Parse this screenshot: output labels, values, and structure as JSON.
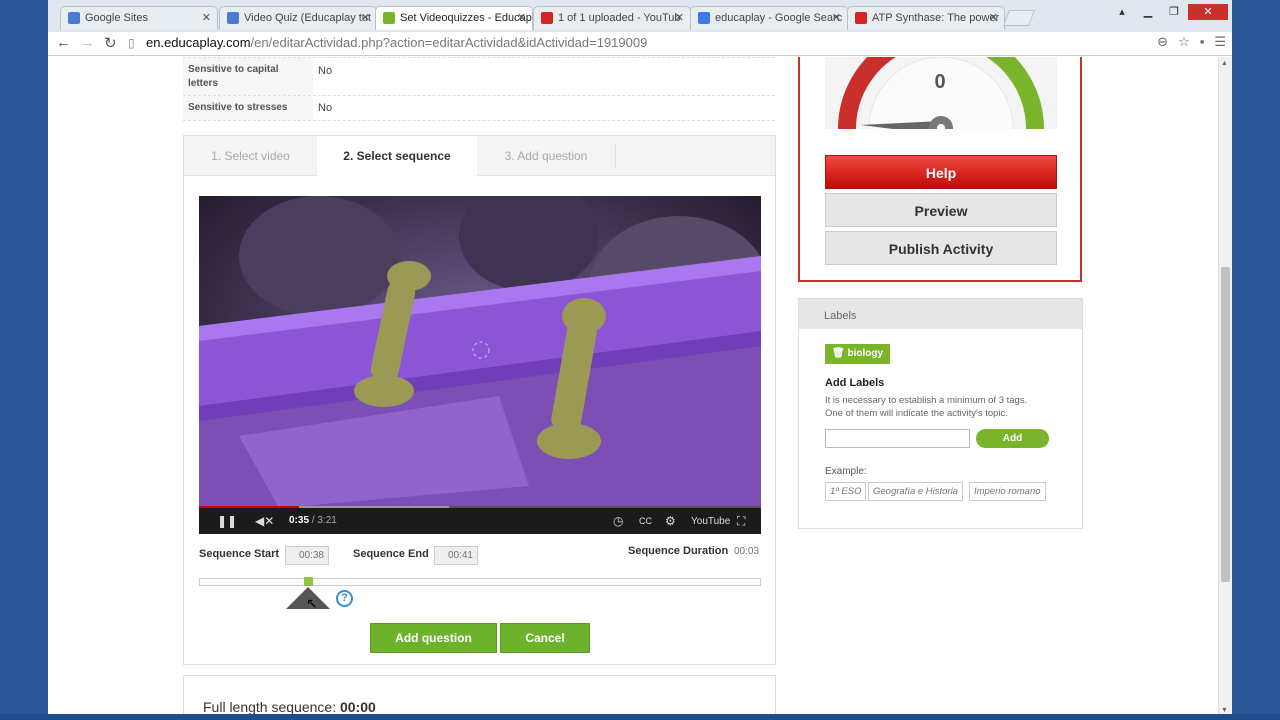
{
  "browser": {
    "tabs": [
      {
        "title": "Google Sites",
        "favicon_color": "#4a7bd0"
      },
      {
        "title": "Video Quiz (Educaplay tut",
        "favicon_color": "#4a7bd0"
      },
      {
        "title": "Set Videoquizzes - Educap",
        "favicon_color": "#7ab42a"
      },
      {
        "title": "1 of 1 uploaded - YouTub",
        "favicon_color": "#d32323"
      },
      {
        "title": "educaplay - Google Searc",
        "favicon_color": "#3b78e7"
      },
      {
        "title": "ATP Synthase: The power",
        "favicon_color": "#d32323"
      }
    ],
    "active_tab_index": 2,
    "url_host": "en.educaplay.com",
    "url_path": "/en/editarActividad.php?action=editarActividad&idActividad=1919009"
  },
  "settings": [
    {
      "key": "Sensitive to capital letters",
      "value": "No"
    },
    {
      "key": "Sensitive to stresses",
      "value": "No"
    }
  ],
  "steps": [
    {
      "label": "1. Select video",
      "active": false
    },
    {
      "label": "2. Select sequence",
      "active": true
    },
    {
      "label": "3. Add question",
      "active": false
    }
  ],
  "video": {
    "current_time": "0:35",
    "duration": "/ 3:21",
    "played_fraction": 0.18,
    "youtube_label": "YouTube"
  },
  "sequence": {
    "start_label": "Sequence Start",
    "start_value": "00:38",
    "end_label": "Sequence End",
    "end_value": "00:41",
    "duration_label": "Sequence Duration",
    "duration_value": "00:03"
  },
  "buttons": {
    "add_question": "Add question",
    "cancel": "Cancel"
  },
  "full_sequence": {
    "label": "Full length sequence:",
    "value": "00:00"
  },
  "meter": {
    "value": "0",
    "help": "Help",
    "preview": "Preview",
    "publish": "Publish Activity"
  },
  "labels": {
    "heading": "Labels",
    "current_tag": "biology",
    "add_heading": "Add Labels",
    "desc_line1": "It is necessary to establish a minimum of 3 tags.",
    "desc_line2": "One of them will indicate the activity's topic.",
    "input_value": "",
    "add_button": "Add",
    "example_label": "Example:",
    "examples": [
      "1º ESO",
      "Geografía e Historia",
      "Imperio romano"
    ]
  },
  "colors": {
    "accent_green": "#6cb32b",
    "help_red": "#d9201a",
    "frame_red": "#c9302c"
  }
}
